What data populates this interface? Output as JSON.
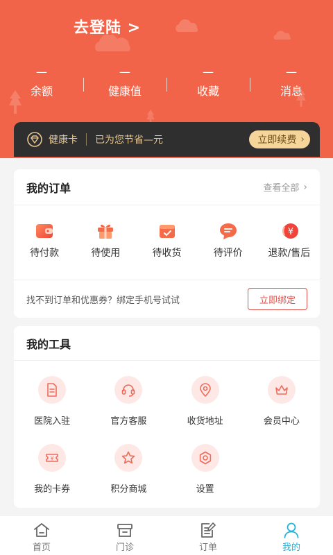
{
  "header": {
    "login_text": "去登陆 >",
    "stats": [
      {
        "value": "—",
        "label": "余额"
      },
      {
        "value": "—",
        "label": "健康值"
      },
      {
        "value": "—",
        "label": "收藏"
      },
      {
        "value": "—",
        "label": "消息"
      }
    ],
    "bg_color": "#f26449"
  },
  "health_card": {
    "title": "健康卡",
    "saving_text": "已为您节省—元",
    "renew_label": "立即续费",
    "icon": "diamond-icon"
  },
  "orders": {
    "title": "我的订单",
    "view_all": "查看全部",
    "items": [
      {
        "label": "待付款",
        "icon": "wallet-icon"
      },
      {
        "label": "待使用",
        "icon": "gift-icon"
      },
      {
        "label": "待收货",
        "icon": "delivery-box-icon"
      },
      {
        "label": "待评价",
        "icon": "comment-icon"
      },
      {
        "label": "退款/售后",
        "icon": "refund-icon"
      }
    ],
    "bind_tip": "找不到订单和优惠券？绑定手机号试试",
    "bind_label": "立即绑定"
  },
  "tools": {
    "title": "我的工具",
    "items": [
      {
        "label": "医院入驻",
        "icon": "document-icon"
      },
      {
        "label": "官方客服",
        "icon": "headset-icon"
      },
      {
        "label": "收货地址",
        "icon": "location-pin-icon"
      },
      {
        "label": "会员中心",
        "icon": "crown-icon"
      },
      {
        "label": "我的卡券",
        "icon": "coupon-icon"
      },
      {
        "label": "积分商城",
        "icon": "star-icon"
      },
      {
        "label": "设置",
        "icon": "settings-gear-icon"
      }
    ]
  },
  "bottom_nav": {
    "items": [
      {
        "label": "首页",
        "icon": "home-icon",
        "active": false
      },
      {
        "label": "门诊",
        "icon": "clinic-icon",
        "active": false
      },
      {
        "label": "订单",
        "icon": "order-list-icon",
        "active": false
      },
      {
        "label": "我的",
        "icon": "user-icon",
        "active": true
      }
    ],
    "active_color": "#27b3d6"
  }
}
